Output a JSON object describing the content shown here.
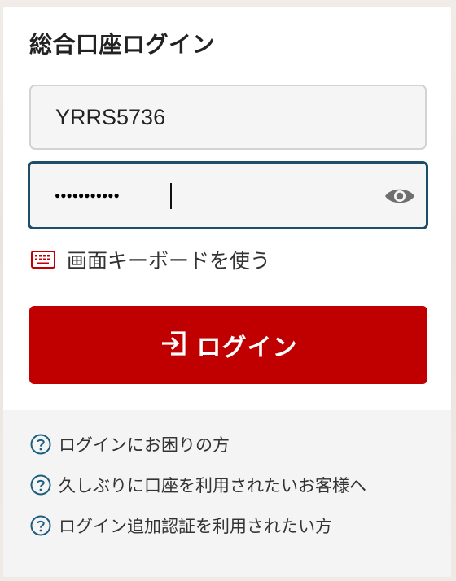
{
  "login": {
    "title": "総合口座ログイン",
    "user_id_value": "YRRS5736",
    "password_value": "●●●●●●●●●●●",
    "show_password_icon": "eye-icon",
    "screen_keyboard_label": "画面キーボードを使う",
    "screen_keyboard_icon": "keyboard-icon",
    "login_button_label": "ログイン",
    "login_button_icon": "login-arrow-icon",
    "accent_color": "#c00000",
    "focus_border_color": "#1d4e68"
  },
  "help": {
    "items": [
      {
        "label": "ログインにお困りの方",
        "icon": "question-circle-icon"
      },
      {
        "label": "久しぶりに口座を利用されたいお客様へ",
        "icon": "question-circle-icon"
      },
      {
        "label": "ログイン追加認証を利用されたい方",
        "icon": "question-circle-icon"
      }
    ]
  }
}
